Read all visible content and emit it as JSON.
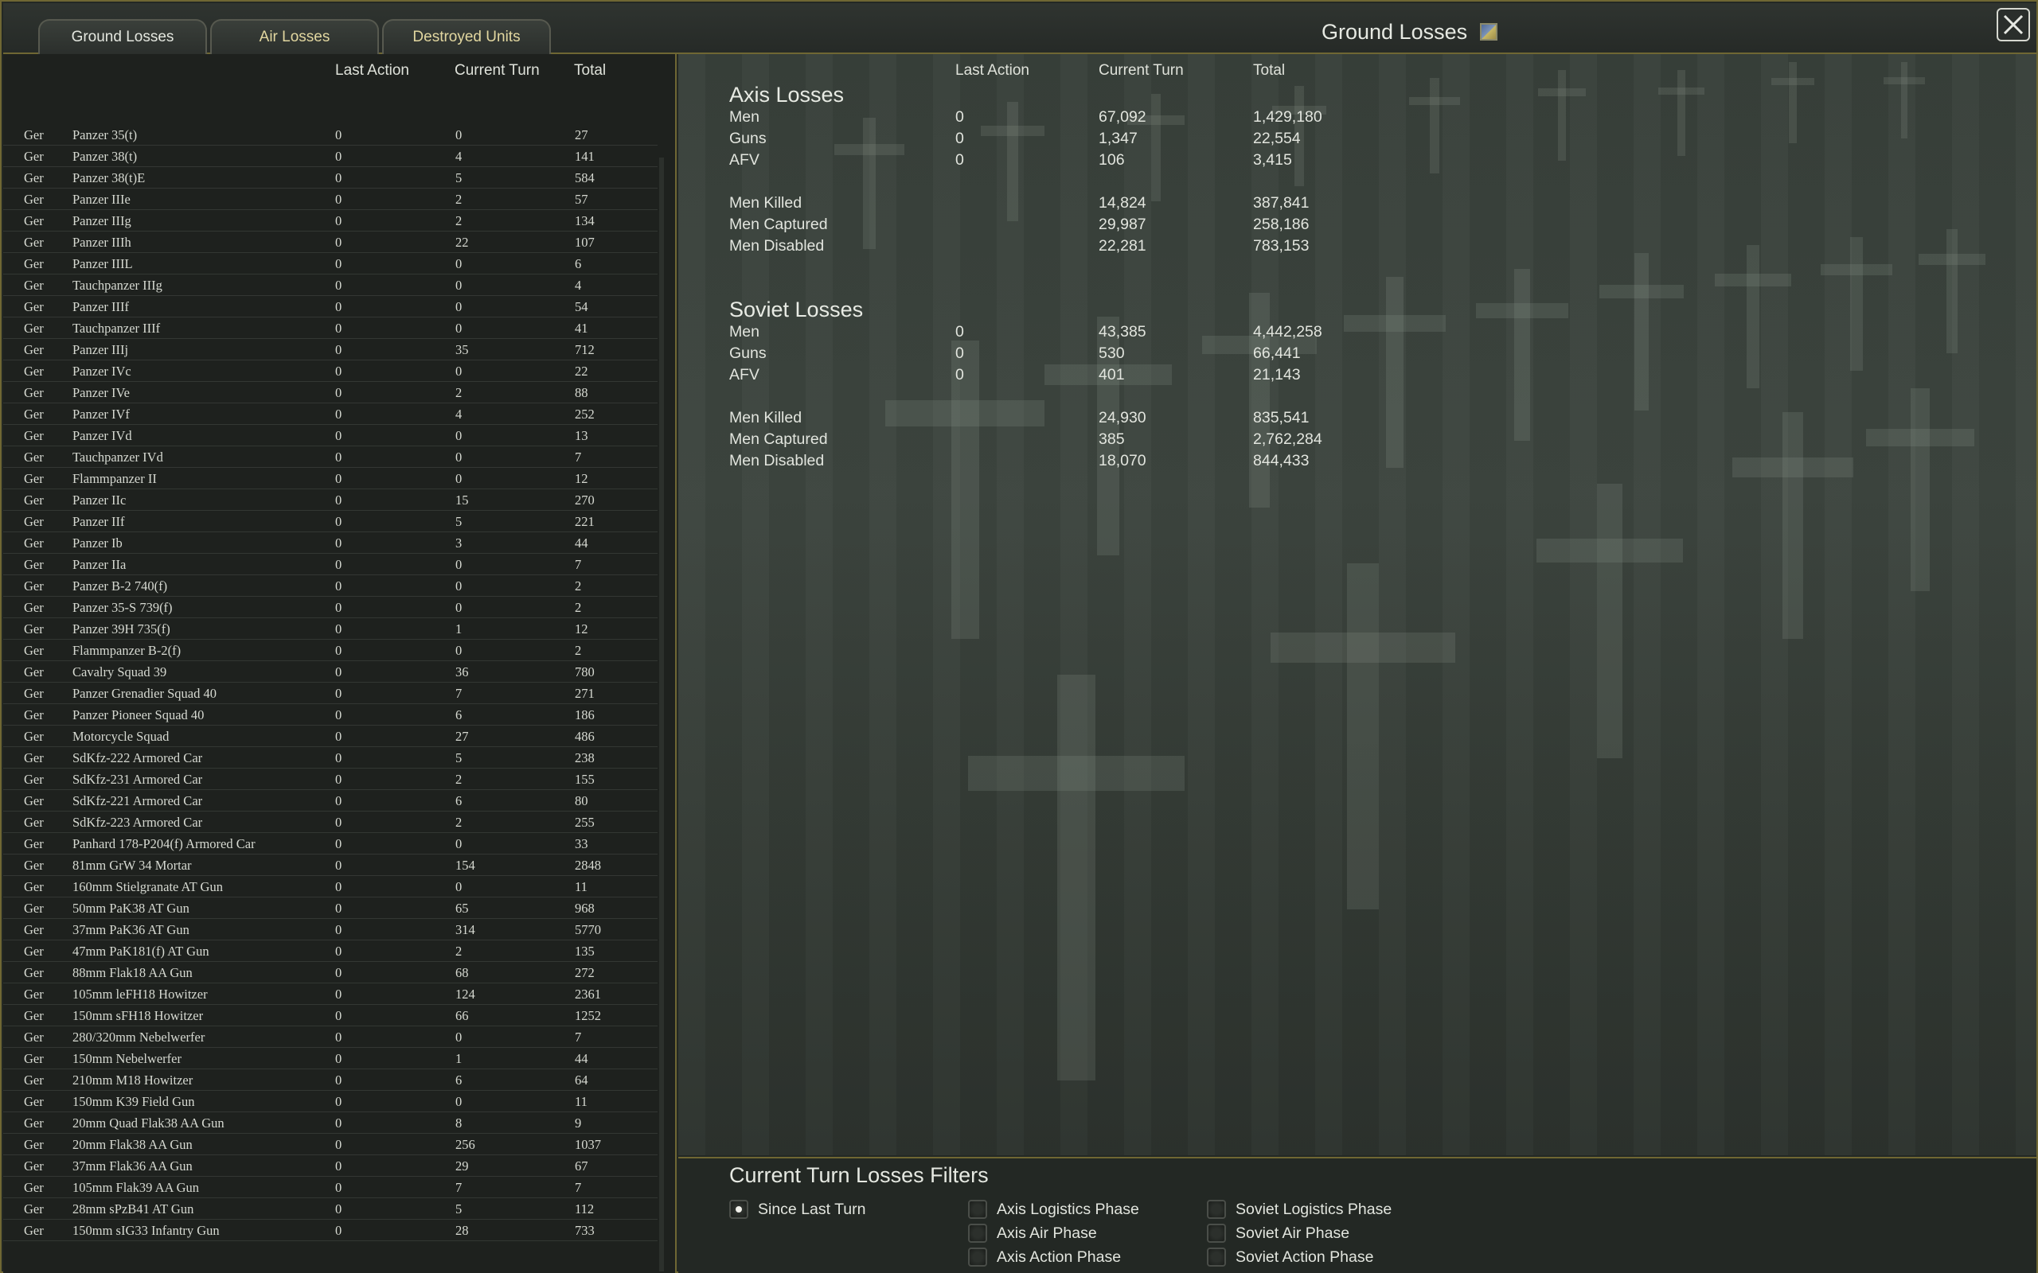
{
  "window": {
    "title": "Ground Losses",
    "tabs": [
      "Ground Losses",
      "Air Losses",
      "Destroyed Units"
    ]
  },
  "list": {
    "headers": {
      "last": "Last Action",
      "current": "Current Turn",
      "total": "Total"
    },
    "rows": [
      [
        "Ger",
        "Panzer 35(t)",
        "0",
        "0",
        "27"
      ],
      [
        "Ger",
        "Panzer 38(t)",
        "0",
        "4",
        "141"
      ],
      [
        "Ger",
        "Panzer 38(t)E",
        "0",
        "5",
        "584"
      ],
      [
        "Ger",
        "Panzer IIIe",
        "0",
        "2",
        "57"
      ],
      [
        "Ger",
        "Panzer IIIg",
        "0",
        "2",
        "134"
      ],
      [
        "Ger",
        "Panzer IIIh",
        "0",
        "22",
        "107"
      ],
      [
        "Ger",
        "Panzer IIIL",
        "0",
        "0",
        "6"
      ],
      [
        "Ger",
        "Tauchpanzer IIIg",
        "0",
        "0",
        "4"
      ],
      [
        "Ger",
        "Panzer IIIf",
        "0",
        "0",
        "54"
      ],
      [
        "Ger",
        "Tauchpanzer IIIf",
        "0",
        "0",
        "41"
      ],
      [
        "Ger",
        "Panzer IIIj",
        "0",
        "35",
        "712"
      ],
      [
        "Ger",
        "Panzer IVc",
        "0",
        "0",
        "22"
      ],
      [
        "Ger",
        "Panzer IVe",
        "0",
        "2",
        "88"
      ],
      [
        "Ger",
        "Panzer IVf",
        "0",
        "4",
        "252"
      ],
      [
        "Ger",
        "Panzer IVd",
        "0",
        "0",
        "13"
      ],
      [
        "Ger",
        "Tauchpanzer IVd",
        "0",
        "0",
        "7"
      ],
      [
        "Ger",
        "Flammpanzer II",
        "0",
        "0",
        "12"
      ],
      [
        "Ger",
        "Panzer IIc",
        "0",
        "15",
        "270"
      ],
      [
        "Ger",
        "Panzer IIf",
        "0",
        "5",
        "221"
      ],
      [
        "Ger",
        "Panzer Ib",
        "0",
        "3",
        "44"
      ],
      [
        "Ger",
        "Panzer IIa",
        "0",
        "0",
        "7"
      ],
      [
        "Ger",
        "Panzer B-2 740(f)",
        "0",
        "0",
        "2"
      ],
      [
        "Ger",
        "Panzer 35-S 739(f)",
        "0",
        "0",
        "2"
      ],
      [
        "Ger",
        "Panzer 39H 735(f)",
        "0",
        "1",
        "12"
      ],
      [
        "Ger",
        "Flammpanzer B-2(f)",
        "0",
        "0",
        "2"
      ],
      [
        "Ger",
        "Cavalry Squad 39",
        "0",
        "36",
        "780"
      ],
      [
        "Ger",
        "Panzer Grenadier Squad 40",
        "0",
        "7",
        "271"
      ],
      [
        "Ger",
        "Panzer Pioneer Squad 40",
        "0",
        "6",
        "186"
      ],
      [
        "Ger",
        "Motorcycle Squad",
        "0",
        "27",
        "486"
      ],
      [
        "Ger",
        "SdKfz-222 Armored Car",
        "0",
        "5",
        "238"
      ],
      [
        "Ger",
        "SdKfz-231 Armored Car",
        "0",
        "2",
        "155"
      ],
      [
        "Ger",
        "SdKfz-221 Armored Car",
        "0",
        "6",
        "80"
      ],
      [
        "Ger",
        "SdKfz-223 Armored Car",
        "0",
        "2",
        "255"
      ],
      [
        "Ger",
        "Panhard 178-P204(f) Armored Car",
        "0",
        "0",
        "33"
      ],
      [
        "Ger",
        "81mm GrW 34 Mortar",
        "0",
        "154",
        "2848"
      ],
      [
        "Ger",
        "160mm Stielgranate AT Gun",
        "0",
        "0",
        "11"
      ],
      [
        "Ger",
        "50mm PaK38 AT Gun",
        "0",
        "65",
        "968"
      ],
      [
        "Ger",
        "37mm PaK36 AT Gun",
        "0",
        "314",
        "5770"
      ],
      [
        "Ger",
        "47mm PaK181(f) AT Gun",
        "0",
        "2",
        "135"
      ],
      [
        "Ger",
        "88mm Flak18 AA Gun",
        "0",
        "68",
        "272"
      ],
      [
        "Ger",
        "105mm leFH18 Howitzer",
        "0",
        "124",
        "2361"
      ],
      [
        "Ger",
        "150mm sFH18 Howitzer",
        "0",
        "66",
        "1252"
      ],
      [
        "Ger",
        "280/320mm Nebelwerfer",
        "0",
        "0",
        "7"
      ],
      [
        "Ger",
        "150mm Nebelwerfer",
        "0",
        "1",
        "44"
      ],
      [
        "Ger",
        "210mm M18 Howitzer",
        "0",
        "6",
        "64"
      ],
      [
        "Ger",
        "150mm K39 Field Gun",
        "0",
        "0",
        "11"
      ],
      [
        "Ger",
        "20mm Quad Flak38 AA Gun",
        "0",
        "8",
        "9"
      ],
      [
        "Ger",
        "20mm Flak38 AA Gun",
        "0",
        "256",
        "1037"
      ],
      [
        "Ger",
        "37mm Flak36 AA Gun",
        "0",
        "29",
        "67"
      ],
      [
        "Ger",
        "105mm Flak39 AA Gun",
        "0",
        "7",
        "7"
      ],
      [
        "Ger",
        "28mm sPzB41 AT Gun",
        "0",
        "5",
        "112"
      ],
      [
        "Ger",
        "150mm sIG33 Infantry Gun",
        "0",
        "28",
        "733"
      ]
    ]
  },
  "summary": {
    "headers": {
      "last": "Last Action",
      "current": "Current Turn",
      "total": "Total"
    },
    "axis": {
      "title": "Axis Losses",
      "rows": [
        [
          "Men",
          "0",
          "67,092",
          "1,429,180"
        ],
        [
          "Guns",
          "0",
          "1,347",
          "22,554"
        ],
        [
          "AFV",
          "0",
          "106",
          "3,415"
        ]
      ],
      "detail": [
        [
          "Men Killed",
          "14,824",
          "387,841"
        ],
        [
          "Men Captured",
          "29,987",
          "258,186"
        ],
        [
          "Men Disabled",
          "22,281",
          "783,153"
        ]
      ]
    },
    "soviet": {
      "title": "Soviet Losses",
      "rows": [
        [
          "Men",
          "0",
          "43,385",
          "4,442,258"
        ],
        [
          "Guns",
          "0",
          "530",
          "66,441"
        ],
        [
          "AFV",
          "0",
          "401",
          "21,143"
        ]
      ],
      "detail": [
        [
          "Men Killed",
          "24,930",
          "835,541"
        ],
        [
          "Men Captured",
          "385",
          "2,762,284"
        ],
        [
          "Men Disabled",
          "18,070",
          "844,433"
        ]
      ]
    }
  },
  "filters": {
    "title": "Current Turn Losses Filters",
    "options": [
      {
        "label": "Since Last Turn",
        "selected": true
      },
      {
        "label": "Axis Logistics Phase",
        "selected": false
      },
      {
        "label": "Axis Air Phase",
        "selected": false
      },
      {
        "label": "Axis Action Phase",
        "selected": false
      },
      {
        "label": "Soviet Logistics Phase",
        "selected": false
      },
      {
        "label": "Soviet Air Phase",
        "selected": false
      },
      {
        "label": "Soviet Action Phase",
        "selected": false
      }
    ]
  },
  "icons": {
    "title": "map-report-icon",
    "close": "close-icon"
  },
  "colors": {
    "border": "#6f6733",
    "tab_inactive_text": "#e2d7a0"
  }
}
